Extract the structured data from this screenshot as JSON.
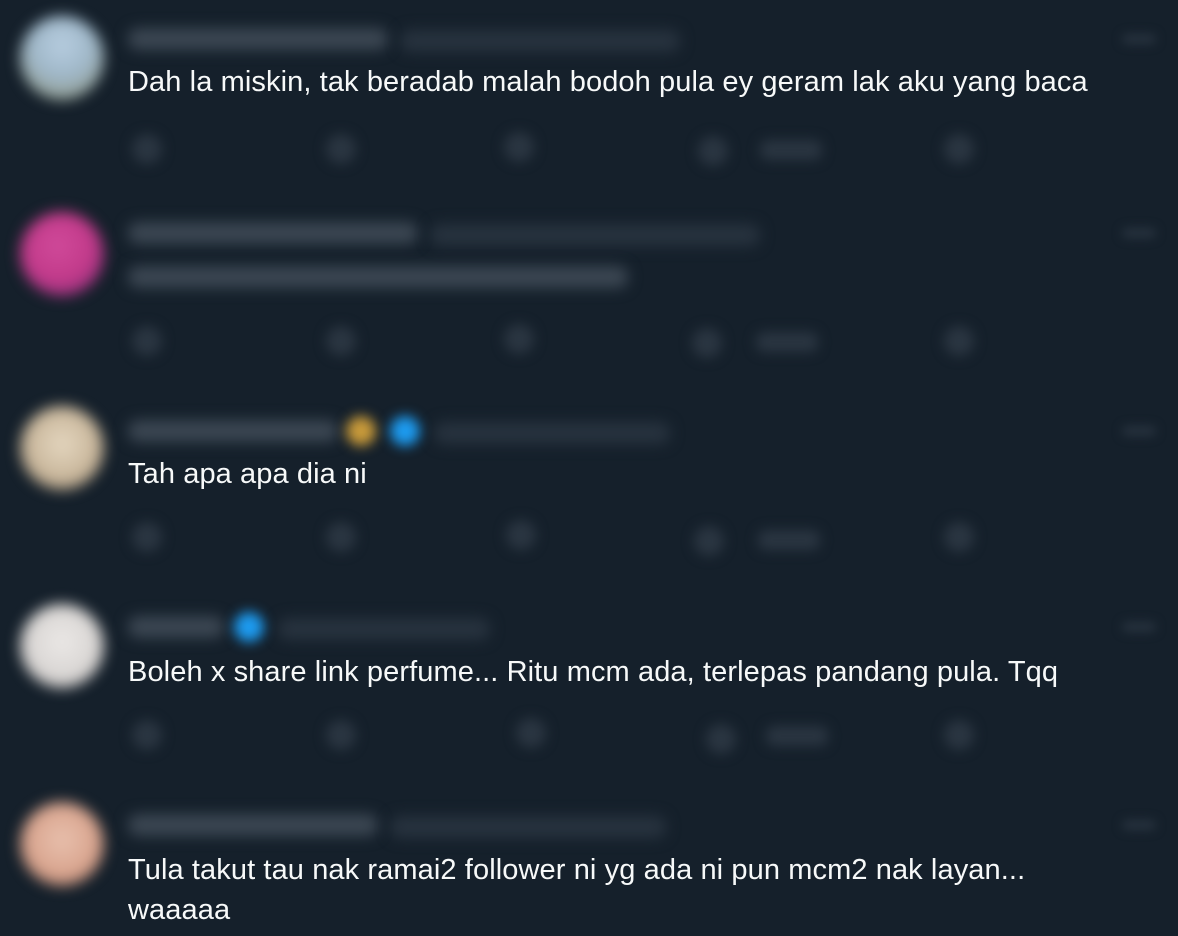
{
  "replies": [
    {
      "text": "Dah la miskin, tak beradab malah bodoh pula ey geram lak aku yang baca",
      "avatar_color": "#9fb7c8",
      "verified": false
    },
    {
      "text": "",
      "avatar_color": "#c23a8a",
      "verified": false
    },
    {
      "text": "Tah apa apa dia ni",
      "avatar_color": "#c9b79c",
      "verified": true,
      "extra_badge_color": "#c89a3a"
    },
    {
      "text": "Boleh x share link perfume... Ritu mcm ada, terlepas pandang pula. Tqq",
      "avatar_color": "#d9d6d4",
      "verified": true
    },
    {
      "text": "Tula takut tau nak ramai2 follower ni yg ada ni pun mcm2 nak layan... waaaaa",
      "avatar_color": "#d9a58f",
      "verified": false
    }
  ],
  "colors": {
    "background": "#15202b",
    "text": "#f7f9f9",
    "verified_badge": "#1d9bf0",
    "blurred_text": "#3b4652"
  },
  "icons": [
    "reply-icon",
    "retweet-icon",
    "like-icon",
    "views-icon",
    "share-icon",
    "more-icon",
    "verified-icon"
  ]
}
